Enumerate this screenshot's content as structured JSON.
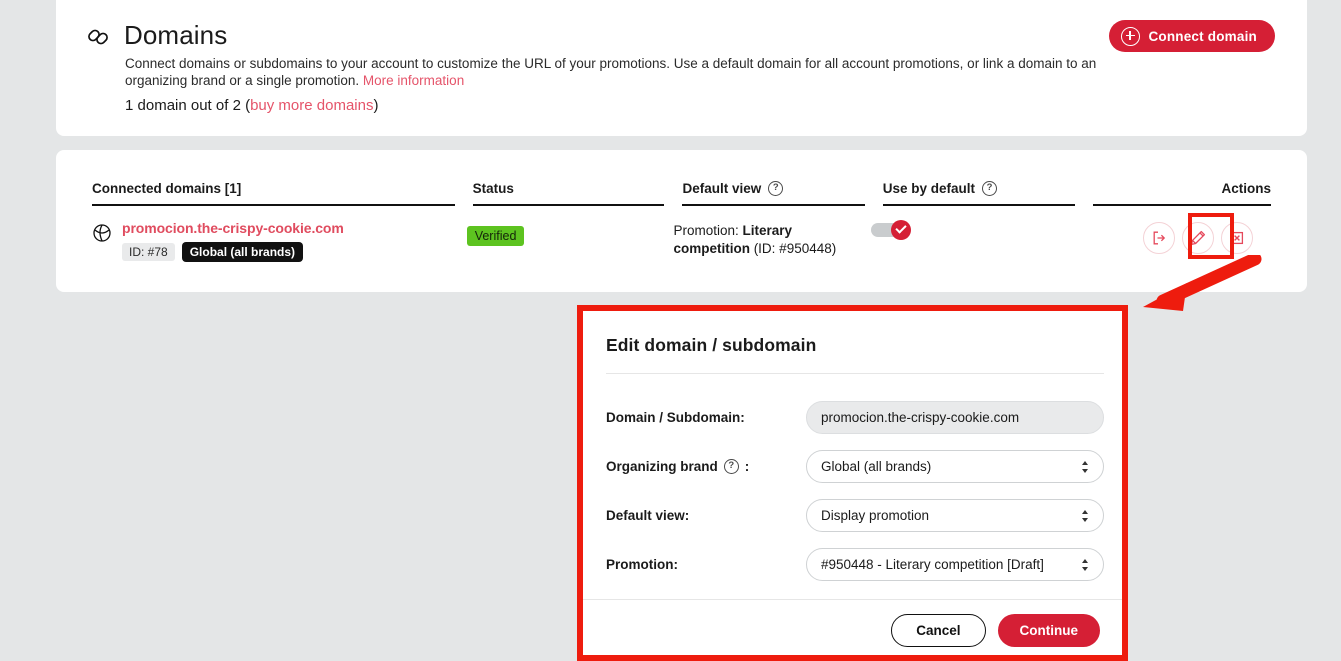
{
  "header": {
    "icon": "link-icon",
    "title": "Domains",
    "description_1": "Connect domains or subdomains to your account to customize the URL of your promotions. Use a default domain for all account promotions, or link a domain to an organizing brand or a single promotion.",
    "description_link": "More information",
    "count_prefix": "1 domain out of 2 (",
    "count_link": "buy more domains",
    "count_suffix": ")",
    "connect_button": "Connect domain",
    "accent_color": "#d51f35",
    "link_color": "#e04c5f"
  },
  "table": {
    "columns": [
      {
        "label": "Connected domains [1]",
        "help": false
      },
      {
        "label": "Status",
        "help": false
      },
      {
        "label": "Default view",
        "help": true
      },
      {
        "label": "Use by default",
        "help": true
      },
      {
        "label": "Actions",
        "help": false
      }
    ],
    "rows": [
      {
        "icon": "globe-icon",
        "domain": "promocion.the-crispy-cookie.com",
        "id_badge": "ID: #78",
        "brand_badge": "Global (all brands)",
        "status": "Verified",
        "status_color": "#5dc320",
        "default_view_prefix": "Promotion: ",
        "default_view_name": "Literary competition",
        "default_view_suffix": " (ID: #950448)",
        "use_by_default": "on",
        "actions": [
          {
            "name": "open-domain-action",
            "icon": "external-link-icon"
          },
          {
            "name": "edit-domain-action",
            "icon": "pencil-icon",
            "highlighted": true
          },
          {
            "name": "delete-domain-action",
            "icon": "close-box-icon"
          }
        ]
      }
    ]
  },
  "modal": {
    "title": "Edit domain / subdomain",
    "fields": [
      {
        "label": "Domain / Subdomain:",
        "help": false,
        "type": "text",
        "value": "promocion.the-crispy-cookie.com",
        "name": "domain-input"
      },
      {
        "label": "Organizing brand",
        "label_suffix": ":",
        "help": true,
        "type": "select",
        "value": "Global (all brands)",
        "name": "organizing-brand-select"
      },
      {
        "label": "Default view:",
        "help": false,
        "type": "select",
        "value": "Display promotion",
        "name": "default-view-select"
      },
      {
        "label": "Promotion:",
        "help": false,
        "type": "select",
        "value": "#950448 - Literary competition [Draft]",
        "name": "promotion-select"
      }
    ],
    "cancel_label": "Cancel",
    "continue_label": "Continue"
  },
  "annotation": {
    "highlight_color": "#ee1c0e",
    "arrow": "points from the edit (pencil) action down-left into the edit modal"
  }
}
